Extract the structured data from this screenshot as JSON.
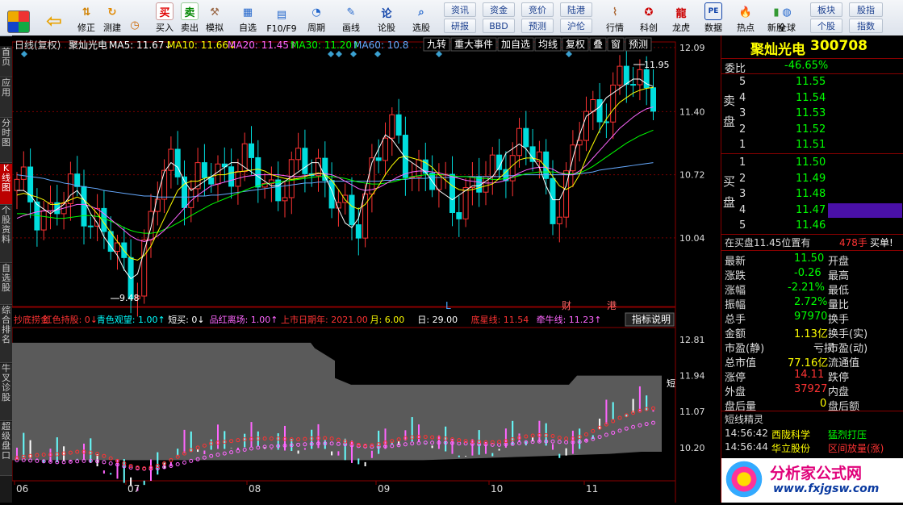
{
  "toolbar": {
    "nav": [
      {
        "label": "修正",
        "icon": "up-down-arrows-icon"
      },
      {
        "label": "测建",
        "icon": "refresh-icon"
      },
      {
        "label": "",
        "icon": "clock-icon"
      }
    ],
    "trade": [
      {
        "label": "买入",
        "icon_text": "买",
        "color": "#e00000"
      },
      {
        "label": "卖出",
        "icon_text": "卖",
        "color": "#008800"
      },
      {
        "label": "模拟",
        "icon": "hammer-icon"
      }
    ],
    "tools": [
      {
        "label": "自选"
      },
      {
        "label": "F10/F9"
      },
      {
        "label": "周期"
      },
      {
        "label": "画线"
      },
      {
        "label": "论股"
      },
      {
        "label": "选股"
      }
    ],
    "grid": [
      [
        "资讯",
        "资金",
        "竞价",
        "陆港"
      ],
      [
        "研报",
        "BBD",
        "预测",
        "沪伦"
      ]
    ],
    "apps": [
      {
        "label": "行情"
      },
      {
        "label": "科创"
      },
      {
        "label": "龙虎"
      },
      {
        "label": "数据"
      },
      {
        "label": "热点"
      },
      {
        "label": "新股"
      }
    ],
    "global": "全球",
    "right_grid": [
      [
        "板块",
        "股指"
      ],
      [
        "个股",
        "指数"
      ]
    ]
  },
  "left_tabs": [
    "首页",
    "应用",
    "分时图",
    "K线图",
    "个股资料",
    "自选股",
    "综合排名",
    "牛叉诊股",
    "超级盘口"
  ],
  "header": {
    "mode": "日线(复权)",
    "name": "聚灿光电",
    "ma": [
      {
        "label": "MA5: 11.67↓",
        "color": "#ffffff"
      },
      {
        "label": "MA10: 11.66↓",
        "color": "#ffff00"
      },
      {
        "label": "MA20: 11.45↑",
        "color": "#ff66ff"
      },
      {
        "label": "MA30: 11.20↑",
        "color": "#00ff00"
      },
      {
        "label": "MA60: 10.8",
        "color": "#66aaff"
      }
    ],
    "tabs": [
      "九转",
      "重大事件",
      "加自选",
      "均线",
      "复权",
      "叠",
      "窗",
      "预测"
    ]
  },
  "chart_data": {
    "type": "candlestick",
    "title": "聚灿光电 日线(复权)",
    "price_ylim": [
      9.3,
      12.15
    ],
    "price_ticks": [
      "12.09",
      "11.40",
      "10.72",
      "10.04"
    ],
    "x_months": [
      "06",
      "07",
      "08",
      "09",
      "10",
      "11"
    ],
    "annotations": {
      "high": "11.95",
      "low": "9.48",
      "markers": [
        "L",
        "财",
        "港"
      ]
    },
    "ma_colors": {
      "ma5": "#ffffff",
      "ma10": "#ffff00",
      "ma20": "#ff66ff",
      "ma30": "#00ff00",
      "ma60": "#66aaff"
    },
    "ma5": [
      10.55,
      10.55,
      10.5,
      10.4,
      10.35,
      10.3,
      10.35,
      10.4,
      10.5,
      10.55,
      10.45,
      10.3,
      10.2,
      10.05,
      9.95,
      9.85,
      9.7,
      9.6,
      9.65,
      9.9,
      10.15,
      10.5,
      10.75,
      10.85,
      10.8,
      10.65,
      10.55,
      10.6,
      10.65,
      10.7,
      10.75,
      10.8,
      10.85,
      10.85,
      10.8,
      10.75,
      10.7,
      10.65,
      10.6,
      10.6,
      10.65,
      10.7,
      10.75,
      10.8,
      10.85,
      10.85,
      10.7,
      10.55,
      10.35,
      10.2,
      10.15,
      10.25,
      10.55,
      10.85,
      11.0,
      11.15,
      11.1,
      11.0,
      10.9,
      10.85,
      10.8,
      10.75,
      10.65,
      10.55,
      10.5,
      10.45,
      10.5,
      10.55,
      10.6,
      10.6,
      10.65,
      10.7,
      10.8,
      10.95,
      11.0,
      11.05,
      11.0,
      10.9,
      10.8,
      10.6,
      10.45,
      10.45,
      10.6,
      10.9,
      11.15,
      11.35,
      11.4,
      11.45,
      11.55,
      11.6,
      11.65,
      11.7,
      11.75,
      11.75,
      11.7,
      11.67
    ],
    "ma10": [
      10.5,
      10.52,
      10.5,
      10.48,
      10.45,
      10.4,
      10.4,
      10.42,
      10.45,
      10.48,
      10.45,
      10.38,
      10.3,
      10.2,
      10.1,
      10.0,
      9.9,
      9.82,
      9.8,
      9.85,
      9.95,
      10.1,
      10.25,
      10.4,
      10.55,
      10.62,
      10.65,
      10.65,
      10.68,
      10.7,
      10.72,
      10.72,
      10.74,
      10.75,
      10.76,
      10.77,
      10.78,
      10.76,
      10.72,
      10.7,
      10.68,
      10.67,
      10.68,
      10.7,
      10.72,
      10.74,
      10.72,
      10.66,
      10.56,
      10.45,
      10.38,
      10.35,
      10.4,
      10.5,
      10.6,
      10.72,
      10.82,
      10.9,
      10.92,
      10.9,
      10.88,
      10.85,
      10.8,
      10.72,
      10.66,
      10.6,
      10.56,
      10.55,
      10.56,
      10.58,
      10.6,
      10.62,
      10.68,
      10.75,
      10.82,
      10.88,
      10.9,
      10.9,
      10.88,
      10.8,
      10.7,
      10.6,
      10.56,
      10.6,
      10.72,
      10.9,
      11.05,
      11.2,
      11.32,
      11.42,
      11.5,
      11.55,
      11.6,
      11.63,
      11.65,
      11.66
    ],
    "ma20": [
      10.25,
      10.28,
      10.3,
      10.32,
      10.33,
      10.33,
      10.34,
      10.36,
      10.38,
      10.4,
      10.4,
      10.38,
      10.35,
      10.3,
      10.24,
      10.18,
      10.12,
      10.06,
      10.02,
      10.0,
      10.02,
      10.06,
      10.12,
      10.2,
      10.28,
      10.36,
      10.44,
      10.5,
      10.55,
      10.6,
      10.62,
      10.64,
      10.66,
      10.68,
      10.7,
      10.71,
      10.72,
      10.72,
      10.72,
      10.72,
      10.71,
      10.7,
      10.7,
      10.71,
      10.72,
      10.73,
      10.73,
      10.72,
      10.69,
      10.65,
      10.61,
      10.57,
      10.55,
      10.56,
      10.58,
      10.62,
      10.66,
      10.7,
      10.73,
      10.75,
      10.76,
      10.76,
      10.75,
      10.74,
      10.72,
      10.7,
      10.68,
      10.66,
      10.65,
      10.64,
      10.63,
      10.63,
      10.64,
      10.66,
      10.7,
      10.74,
      10.77,
      10.79,
      10.8,
      10.8,
      10.78,
      10.74,
      10.72,
      10.72,
      10.76,
      10.82,
      10.9,
      10.98,
      11.06,
      11.14,
      11.22,
      11.28,
      11.34,
      11.39,
      11.43,
      11.45
    ],
    "ma30": [
      10.3,
      10.3,
      10.29,
      10.28,
      10.27,
      10.26,
      10.25,
      10.25,
      10.26,
      10.27,
      10.28,
      10.28,
      10.27,
      10.25,
      10.22,
      10.19,
      10.15,
      10.12,
      10.1,
      10.09,
      10.09,
      10.1,
      10.13,
      10.16,
      10.2,
      10.24,
      10.28,
      10.32,
      10.36,
      10.4,
      10.43,
      10.46,
      10.49,
      10.52,
      10.55,
      10.58,
      10.6,
      10.62,
      10.63,
      10.64,
      10.65,
      10.66,
      10.67,
      10.68,
      10.69,
      10.7,
      10.7,
      10.7,
      10.69,
      10.68,
      10.66,
      10.64,
      10.63,
      10.62,
      10.62,
      10.63,
      10.64,
      10.66,
      10.68,
      10.7,
      10.71,
      10.72,
      10.72,
      10.72,
      10.72,
      10.71,
      10.7,
      10.7,
      10.69,
      10.68,
      10.68,
      10.67,
      10.67,
      10.68,
      10.69,
      10.71,
      10.73,
      10.74,
      10.75,
      10.75,
      10.75,
      10.74,
      10.73,
      10.73,
      10.74,
      10.77,
      10.81,
      10.86,
      10.91,
      10.96,
      11.01,
      11.06,
      11.1,
      11.14,
      11.17,
      11.2
    ],
    "ma60": [
      10.72,
      10.71,
      10.7,
      10.69,
      10.68,
      10.66,
      10.65,
      10.63,
      10.62,
      10.6,
      10.59,
      10.58,
      10.57,
      10.55,
      10.54,
      10.53,
      10.52,
      10.51,
      10.5,
      10.49,
      10.49,
      10.48,
      10.48,
      10.48,
      10.48,
      10.48,
      10.48,
      10.49,
      10.49,
      10.5,
      10.5,
      10.51,
      10.52,
      10.53,
      10.54,
      10.55,
      10.56,
      10.57,
      10.58,
      10.59,
      10.6,
      10.61,
      10.62,
      10.63,
      10.63,
      10.64,
      10.64,
      10.65,
      10.65,
      10.65,
      10.65,
      10.65,
      10.65,
      10.65,
      10.65,
      10.66,
      10.66,
      10.67,
      10.67,
      10.68,
      10.68,
      10.68,
      10.69,
      10.69,
      10.69,
      10.69,
      10.7,
      10.7,
      10.7,
      10.7,
      10.7,
      10.7,
      10.7,
      10.71,
      10.71,
      10.72,
      10.72,
      10.72,
      10.72,
      10.72,
      10.72,
      10.72,
      10.72,
      10.72,
      10.73,
      10.74,
      10.75,
      10.77,
      10.78,
      10.79,
      10.8,
      10.81,
      10.82,
      10.83,
      10.84,
      10.85
    ],
    "indicator_legend": [
      {
        "label": "抄底捞金",
        "color": "#ff3333"
      },
      {
        "label": "红色持股: 0↓",
        "color": "#ff3333"
      },
      {
        "label": "青色观望: 1.00↑",
        "color": "#00ffff"
      },
      {
        "label": "短买: 0↓",
        "color": "#ffffff"
      },
      {
        "label": "品红离场: 1.00↑",
        "color": "#ff66ff"
      },
      {
        "label": "上市日期年: 2021.00",
        "color": "#ff3333"
      },
      {
        "label": "月: 6.00",
        "color": "#ffff00"
      },
      {
        "label": "日: 29.00",
        "color": "#ffffff"
      },
      {
        "label": "底星线: 11.54",
        "color": "#ff3333"
      },
      {
        "label": "牵牛线: 11.23↑",
        "color": "#ff66ff"
      }
    ],
    "indicator_btn": "指标说明",
    "indicator_ticks": [
      "12.81",
      "11.94",
      "11.07",
      "10.20"
    ],
    "indicator_tag": "短"
  },
  "panel": {
    "stock_name": "聚灿光电",
    "stock_code": "300708",
    "weibi_label": "委比",
    "weibi_value": "-46.65%",
    "sell_label": "卖盘",
    "buy_label": "买盘",
    "asks": [
      {
        "n": "5",
        "p": "11.55"
      },
      {
        "n": "4",
        "p": "11.54"
      },
      {
        "n": "3",
        "p": "11.53"
      },
      {
        "n": "2",
        "p": "11.52"
      },
      {
        "n": "1",
        "p": "11.51"
      }
    ],
    "bids": [
      {
        "n": "1",
        "p": "11.50"
      },
      {
        "n": "2",
        "p": "11.49"
      },
      {
        "n": "3",
        "p": "11.48"
      },
      {
        "n": "4",
        "p": "11.47"
      },
      {
        "n": "5",
        "p": "11.46"
      }
    ],
    "info_line": {
      "text": "在买盘11.45位置有",
      "qty": "478手",
      "tail": "买单!"
    },
    "stats": [
      {
        "l": "最新",
        "v": "11.50",
        "r": "开盘",
        "vc": "#00ff00"
      },
      {
        "l": "涨跌",
        "v": "-0.26",
        "r": "最高",
        "vc": "#00ff00"
      },
      {
        "l": "涨幅",
        "v": "-2.21%",
        "r": "最低",
        "vc": "#00ff00"
      },
      {
        "l": "振幅",
        "v": "2.72%",
        "r": "量比",
        "vc": "#00ff00"
      },
      {
        "l": "总手",
        "v": "97970",
        "r": "换手",
        "vc": "#00ff00"
      },
      {
        "l": "金额",
        "v": "1.13亿",
        "r": "换手(实)",
        "vc": "#ffff00"
      },
      {
        "l": "市盈(静)",
        "v": "亏损",
        "r": "市盈(动)",
        "vc": "#dddddd"
      },
      {
        "l": "总市值",
        "v": "77.16亿",
        "r": "流通值",
        "vc": "#ffff00"
      },
      {
        "l": "涨停",
        "v": "14.11",
        "r": "跌停",
        "vc": "#ff3333"
      },
      {
        "l": "外盘",
        "v": "37927",
        "r": "内盘",
        "vc": "#ff3333"
      },
      {
        "l": "盘后量",
        "v": "0",
        "r": "盘后额",
        "vc": "#ffff00"
      }
    ],
    "sprite_title": "短线精灵",
    "sprites": [
      {
        "t": "14:56:42",
        "n": "西陇科学",
        "e": "猛烈打压",
        "c": "#00ff00"
      },
      {
        "t": "14:56:44",
        "n": "华立股份",
        "e": "区间放量(涨)",
        "c": "#ff3333"
      }
    ],
    "watermark_cn": "分析家公式网",
    "watermark_url": "www.fxjgsw.com"
  }
}
